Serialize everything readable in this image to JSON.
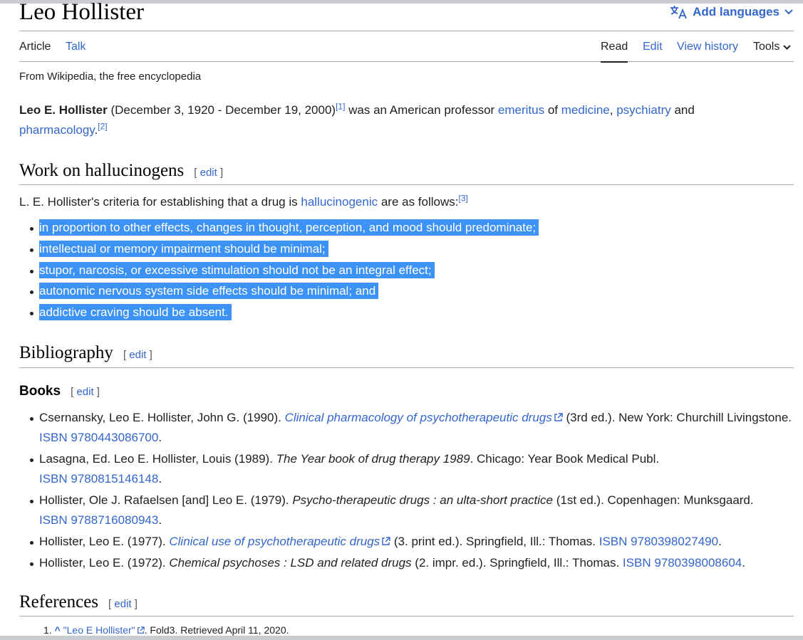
{
  "header": {
    "title": "Leo Hollister",
    "add_languages": "Add languages"
  },
  "tabs": {
    "article": "Article",
    "talk": "Talk",
    "read": "Read",
    "edit": "Edit",
    "view_history": "View history",
    "tools": "Tools"
  },
  "tagline": "From Wikipedia, the free encyclopedia",
  "intro": {
    "name": "Leo E. Hollister",
    "dates": " (December 3, 1920 - December 19, 2000)",
    "ref1": "[1]",
    "text1": " was an American professor ",
    "link_emeritus": "emeritus",
    "text2": " of ",
    "link_medicine": "medicine",
    "comma": ", ",
    "link_psychiatry": "psychiatry",
    "text3": " and",
    "link_pharmacology": "pharmacology",
    "period": ".",
    "ref2": "[2]"
  },
  "section_edit": {
    "open": "[",
    "label": "edit",
    "close": "]"
  },
  "work": {
    "heading": "Work on hallucinogens",
    "intro_pre": "L. E. Hollister's criteria for establishing that a drug is ",
    "link_hallucinogenic": "hallucinogenic",
    "intro_post": " are as follows:",
    "ref3": "[3]",
    "criteria": [
      "in proportion to other effects, changes in thought, perception, and mood should predominate;",
      "intellectual or memory impairment should be minimal;",
      "stupor, narcosis, or excessive stimulation should not be an integral effect;",
      "autonomic nervous system side effects should be minimal; and",
      "addictive craving should be absent."
    ]
  },
  "bibliography": {
    "heading": "Bibliography",
    "books_heading": "Books",
    "books": [
      {
        "pre": "Csernansky, Leo E. Hollister, John G. (1990). ",
        "title": "Clinical pharmacology of psychotherapeutic drugs",
        "post": " (3rd ed.). New York: Churchill Livingstone. ",
        "isbn": "ISBN 9780443086700",
        "end": "."
      },
      {
        "pre": "Lasagna, Ed. Leo E. Hollister, Louis (1989). ",
        "title": "The Year book of drug therapy 1989",
        "post": ". Chicago: Year Book Medical Publ. ",
        "isbn": "ISBN 9780815146148",
        "end": "."
      },
      {
        "pre": "Hollister, Ole J. Rafaelsen [and] Leo E. (1979). ",
        "title": "Psycho-therapeutic drugs : an ulta-short practice",
        "post": " (1st ed.). Copenhagen: Munksgaard. ",
        "isbn": "ISBN 9788716080943",
        "end": "."
      },
      {
        "pre": "Hollister, Leo E. (1977). ",
        "title": "Clinical use of psychotherapeutic drugs",
        "post": " (3. print ed.). Springfield, Ill.: Thomas. ",
        "isbn": "ISBN 9780398027490",
        "end": "."
      },
      {
        "pre": "Hollister, Leo E. (1972). ",
        "title": "Chemical psychoses : LSD and related drugs",
        "post": " (2. impr. ed.). Springfield, Ill.: Thomas. ",
        "isbn": "ISBN 9780398008604",
        "end": "."
      }
    ]
  },
  "references": {
    "heading": "References",
    "items": [
      {
        "num": "1.",
        "caret": "^",
        "link": "\"Leo E Hollister\"",
        "text": ". Fold3. Retrieved April 11, 2020."
      }
    ]
  },
  "colors": {
    "link": "#3366cc",
    "selection": "#3d92f5",
    "border": "#a2a9b1"
  }
}
